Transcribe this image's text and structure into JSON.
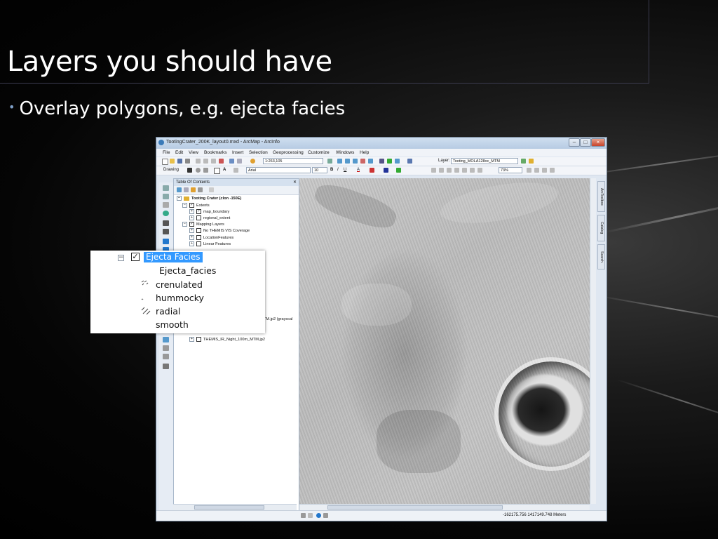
{
  "slide": {
    "title": "Layers you should have",
    "bullet": "Overlay polygons, e.g. ejecta facies"
  },
  "arcmap": {
    "window_title": "TootingCrater_200K_layout0.mxd - ArcMap - ArcInfo",
    "menu": [
      "File",
      "Edit",
      "View",
      "Bookmarks",
      "Insert",
      "Selection",
      "Geoprocessing",
      "Customize",
      "Windows",
      "Help"
    ],
    "scale": "1:263,105",
    "layer_label": "Layer:",
    "layer_value": "Tooting_MOLA128oc_MTM",
    "drawing_label": "Drawing",
    "font_name": "Arial",
    "font_size": "10",
    "zoom_pct": "73%",
    "toc_title": "Table Of Contents",
    "toc_rows": [
      {
        "label": "Tooting Crater (clon -150E)"
      },
      {
        "label": "Extents"
      },
      {
        "label": "map_boundary"
      },
      {
        "label": "regional_extent"
      },
      {
        "label": "Mapping Layers"
      },
      {
        "label": "No THEMIS VIS Coverage"
      },
      {
        "label": "LocationFeatures"
      },
      {
        "label": "Linear Features"
      }
    ],
    "toc_lower_rows": [
      {
        "label": "TM.jp2 (grayscal"
      },
      {
        "label": "THEMIS_IR_Night_100m_MTM.jp2"
      }
    ],
    "side_tabs": [
      "ArcToolbox",
      "Catalog",
      "Search"
    ],
    "coordinates": "-162175.756  1417149.748 Meters"
  },
  "legend_callout": {
    "layer_name": "Ejecta Facies",
    "field_name": "Ejecta_facies",
    "classes": [
      "crenulated",
      "hummocky",
      "radial",
      "smooth"
    ]
  }
}
